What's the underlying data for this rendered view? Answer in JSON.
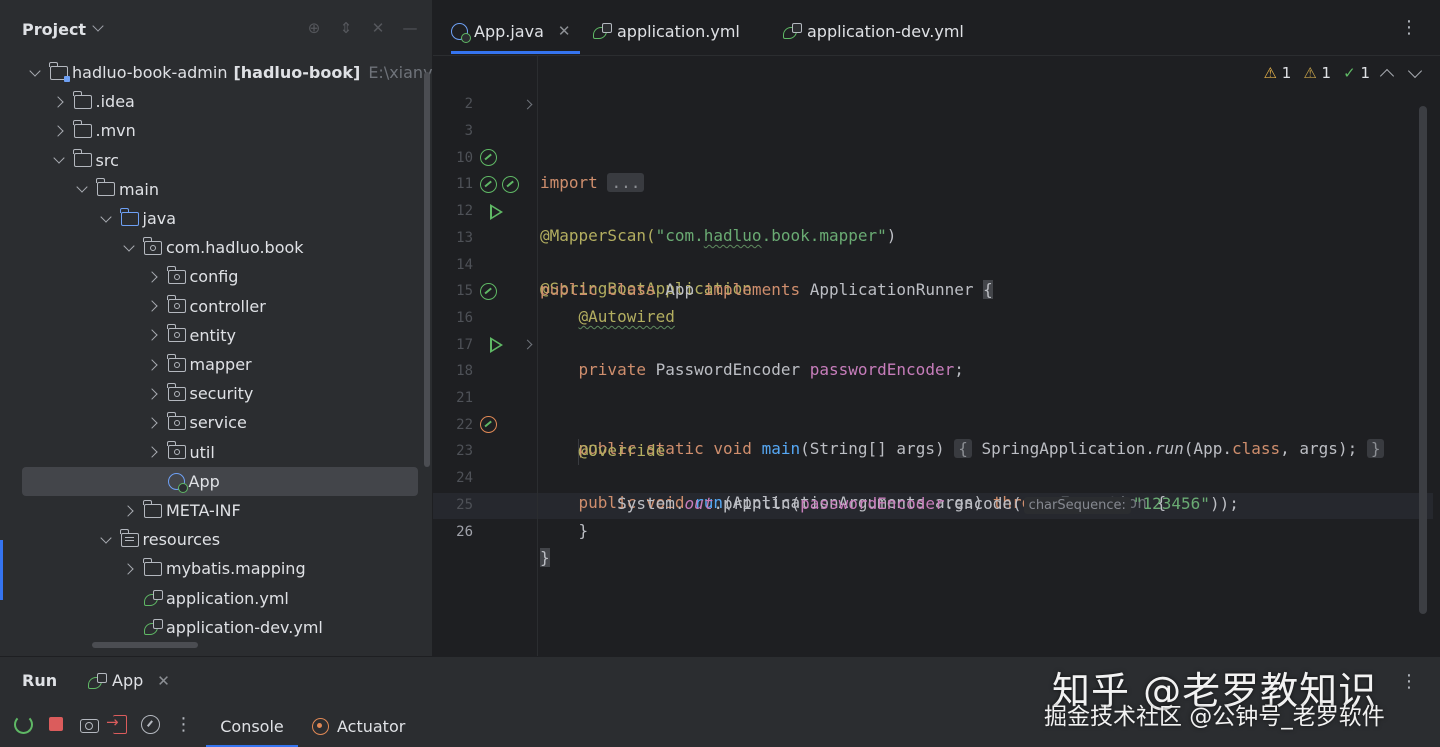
{
  "project_panel": {
    "title": "Project",
    "tree": [
      {
        "label": "hadluo-book-admin",
        "bold": "[hadluo-book]",
        "dim": "E:\\xianyu_ga",
        "icon": "module-folder-icon",
        "arrow": "down",
        "indent": 0
      },
      {
        "label": ".idea",
        "icon": "folder-icon",
        "arrow": "right",
        "indent": 1
      },
      {
        "label": ".mvn",
        "icon": "folder-icon",
        "arrow": "right",
        "indent": 1
      },
      {
        "label": "src",
        "icon": "folder-icon",
        "arrow": "down",
        "indent": 1
      },
      {
        "label": "main",
        "icon": "folder-icon",
        "arrow": "down",
        "indent": 2
      },
      {
        "label": "java",
        "icon": "source-folder-icon",
        "arrow": "down",
        "indent": 3
      },
      {
        "label": "com.hadluo.book",
        "icon": "package-icon",
        "arrow": "down",
        "indent": 4
      },
      {
        "label": "config",
        "icon": "package-icon",
        "arrow": "right",
        "indent": 5
      },
      {
        "label": "controller",
        "icon": "package-icon",
        "arrow": "right",
        "indent": 5
      },
      {
        "label": "entity",
        "icon": "package-icon",
        "arrow": "right",
        "indent": 5
      },
      {
        "label": "mapper",
        "icon": "package-icon",
        "arrow": "right",
        "indent": 5
      },
      {
        "label": "security",
        "icon": "package-icon",
        "arrow": "right",
        "indent": 5
      },
      {
        "label": "service",
        "icon": "package-icon",
        "arrow": "right",
        "indent": 5
      },
      {
        "label": "util",
        "icon": "package-icon",
        "arrow": "right",
        "indent": 5
      },
      {
        "label": "App",
        "icon": "spring-class-icon",
        "arrow": "none",
        "indent": 5,
        "selected": true
      },
      {
        "label": "META-INF",
        "icon": "folder-icon",
        "arrow": "right",
        "indent": 4
      },
      {
        "label": "resources",
        "icon": "resources-folder-icon",
        "arrow": "down",
        "indent": 3
      },
      {
        "label": "mybatis.mapping",
        "icon": "folder-icon",
        "arrow": "right",
        "indent": 4
      },
      {
        "label": "application.yml",
        "icon": "yml-icon",
        "arrow": "none",
        "indent": 4
      },
      {
        "label": "application-dev.yml",
        "icon": "yml-icon",
        "arrow": "none",
        "indent": 4
      }
    ]
  },
  "editor": {
    "tabs": [
      {
        "label": "App.java",
        "icon": "spring-class-icon",
        "active": true,
        "closable": true
      },
      {
        "label": "application.yml",
        "icon": "yml-icon",
        "active": false,
        "closable": false
      },
      {
        "label": "application-dev.yml",
        "icon": "yml-icon",
        "active": false,
        "closable": false
      }
    ],
    "inspections": {
      "warnings": "1",
      "weak_warnings": "1",
      "ok": "1"
    },
    "lines": [
      {
        "n": "2"
      },
      {
        "n": "3",
        "fold": true
      },
      {
        "n": "10"
      },
      {
        "n": "11",
        "gutter": "bean-icon"
      },
      {
        "n": "12",
        "gutter": "bean-icon"
      },
      {
        "n": "13",
        "gutter": "run-icon"
      },
      {
        "n": "14"
      },
      {
        "n": "15"
      },
      {
        "n": "16",
        "gutter": "bean-icon"
      },
      {
        "n": "17"
      },
      {
        "n": "18",
        "gutter": "run-icon",
        "fold": true
      },
      {
        "n": "21"
      },
      {
        "n": "22"
      },
      {
        "n": "23",
        "gutter": "override-icon"
      },
      {
        "n": "24"
      },
      {
        "n": "25"
      },
      {
        "n": "26",
        "current": true
      }
    ],
    "code": {
      "l3_kw": "import",
      "l3_fold": "...",
      "l11_ann": "@MapperScan(",
      "l11_str_a": "\"com.",
      "l11_str_b": "hadluo",
      "l11_str_c": ".book.mapper\"",
      "l11_end": ")",
      "l12_ann": "@SpringBootApplication",
      "l13_kw1": "public class ",
      "l13_name": "App ",
      "l13_kw2": "implements ",
      "l13_type": "ApplicationRunner ",
      "l13_brace": "{",
      "l15_ann": "@Autowired",
      "l16_kw": "private ",
      "l16_type": "PasswordEncoder ",
      "l16_field": "passwordEncoder",
      "l16_end": ";",
      "l18_kw": "public static void ",
      "l18_fn": "main",
      "l18_args": "(String[] args) ",
      "l18_fold_open": "{",
      "l18_body_a": " SpringApplication.",
      "l18_body_run": "run",
      "l18_body_b": "(App.",
      "l18_body_class": "class",
      "l18_body_c": ", args); ",
      "l18_fold_close": "}",
      "l22_ann": "@Override",
      "l23_kw": "public void ",
      "l23_fn": "run",
      "l23_args": "(ApplicationArguments args) ",
      "l23_throws": "throws ",
      "l23_exc": "Exception ",
      "l23_brace": "{",
      "l24_a": "System.",
      "l24_out": "out",
      "l24_b": ".println(",
      "l24_field": "passwordEncoder",
      "l24_c": ".encode(",
      "l24_hint": "charSequence:",
      "l24_str": "\"123456\"",
      "l24_d": "));",
      "l25": "}",
      "l26": "}"
    }
  },
  "run_panel": {
    "title": "Run",
    "tab_label": "App",
    "console_label": "Console",
    "actuator_label": "Actuator"
  },
  "watermark": {
    "line1": "知乎 @老罗教知识",
    "line2": "掘金技术社区 @公钟号_老罗软件"
  },
  "colors": {
    "accent": "#3574f0",
    "keyword": "#cf8e6d",
    "annotation": "#b3ae60",
    "string": "#6aab73",
    "field": "#c77dbb",
    "function": "#56a8f5"
  }
}
